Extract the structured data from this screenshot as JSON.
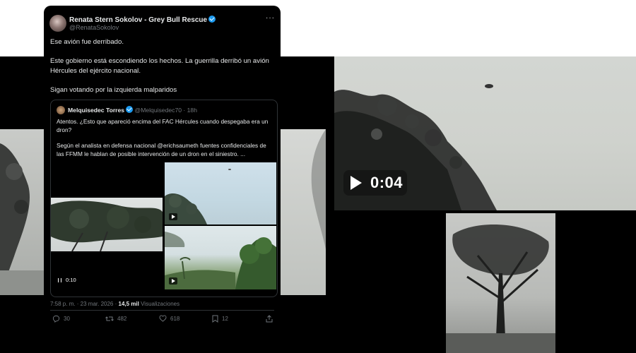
{
  "tweet": {
    "display_name": "Renata Stern Sokolov - Grey Bull Rescue",
    "handle": "@RenataSokolov",
    "line1": "Ese avión fue derribado.",
    "line2": "Este gobierno está escondiendo los hechos. La guerrilla derribó un avión",
    "line3": "Hércules del ejército nacional.",
    "line4": "Sigan votando por la izquierda malparidos",
    "timestamp": "7:58 p. m. · 23 mar. 2026 ·",
    "views_count": "14,5 mil",
    "views_label": "Visualizaciones",
    "replies": "30",
    "retweets": "482",
    "likes": "618",
    "bookmarks": "12"
  },
  "quoted": {
    "name": "Melquisedec Torres",
    "handle_time": "@Melquisedec70 · 18h",
    "line1": "Atentos. ¿Esto que apareció encima del FAC Hércules cuando despegaba era un",
    "line2": "dron?",
    "line3": "Según el analista en defensa nacional @erichsaumeth fuentes confidenciales de",
    "line4": "las FFMM le hablan de posible intervención de un dron en el siniestro. ...",
    "video_time": "0:10"
  },
  "video_overlay": {
    "duration": "0:04"
  },
  "icons": [
    "verified-badge-icon",
    "more-icon",
    "play-icon",
    "pause-icon",
    "reply-icon",
    "retweet-icon",
    "like-icon",
    "bookmark-icon",
    "share-icon"
  ],
  "colors": {
    "accent": "#1d9bf0",
    "background": "#000000",
    "muted": "#71767b",
    "text": "#e7e9ea"
  }
}
